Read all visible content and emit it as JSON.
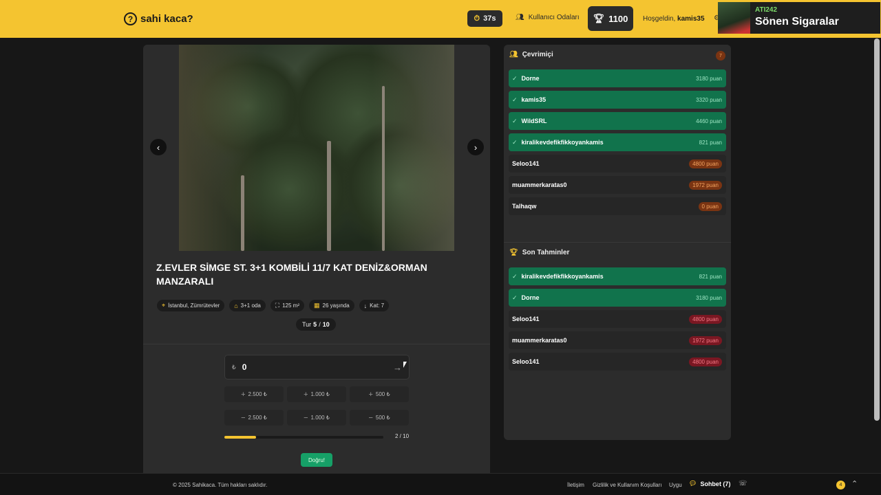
{
  "header": {
    "logo_text": "sahi kaca?",
    "timer": "37s",
    "rooms_label": "Kullanıcı Odaları",
    "score": "1100",
    "welcome_prefix": "Hoşgeldin,",
    "username": "kamis35",
    "notification": {
      "title": "ATI242",
      "subtitle": "Sönen Sigaralar"
    }
  },
  "listing": {
    "title": "Z.EVLER SİMGE ST. 3+1 KOMBİLİ 11/7 KAT DENİZ&ORMAN MANZARALI",
    "chips": [
      {
        "icon": "location-icon",
        "label": "İstanbul, Zümrütevler"
      },
      {
        "icon": "home-icon",
        "label": "3+1 oda"
      },
      {
        "icon": "area-icon",
        "label": "125 m²"
      },
      {
        "icon": "building-icon",
        "label": "26 yaşında"
      },
      {
        "icon": "floor-arrow-icon",
        "label": "Kat: 7"
      }
    ],
    "round_label": "Tur",
    "round_current": "5",
    "round_sep": "/",
    "round_total": "10"
  },
  "guess": {
    "currency": "₺",
    "value": "0",
    "buttons_plus": [
      "2.500 ₺",
      "1.000 ₺",
      "500 ₺"
    ],
    "buttons_minus": [
      "2.500 ₺",
      "1.000 ₺",
      "500 ₺"
    ],
    "progress_fraction": 0.2,
    "progress_text": "2 / 10",
    "correct_label": "Doğru!"
  },
  "online": {
    "title": "Çevrimiçi",
    "count": "7",
    "users": [
      {
        "name": "Dorne",
        "points": "3180 puan",
        "guessed": true
      },
      {
        "name": "kamis35",
        "points": "3320 puan",
        "guessed": true
      },
      {
        "name": "WildSRL",
        "points": "4460 puan",
        "guessed": true
      },
      {
        "name": "kiralikevdefikfikkoyankamis",
        "points": "821 puan",
        "guessed": true
      },
      {
        "name": "Seloo141",
        "points": "4800 puan",
        "guessed": false
      },
      {
        "name": "muammerkaratas0",
        "points": "1972 puan",
        "guessed": false
      },
      {
        "name": "Talhaqw",
        "points": "0 puan",
        "guessed": false
      }
    ]
  },
  "recent": {
    "title": "Son Tahminler",
    "guesses": [
      {
        "name": "kiralikevdefikfikkoyankamis",
        "points": "821 puan",
        "correct": true
      },
      {
        "name": "Dorne",
        "points": "3180 puan",
        "correct": true
      },
      {
        "name": "Seloo141",
        "points": "4800 puan",
        "correct": false
      },
      {
        "name": "muammerkaratas0",
        "points": "1972 puan",
        "correct": false
      },
      {
        "name": "Seloo141",
        "points": "4800 puan",
        "correct": false
      }
    ]
  },
  "footer": {
    "copyright": "© 2025 Sahikaca. Tüm hakları saklıdır.",
    "links": [
      "İletişim",
      "Gizlilik ve Kullanım Koşulları",
      "Uygu"
    ],
    "chat_label": "Sohbet (7)",
    "badge": "4"
  },
  "colors": {
    "accent": "#f4c430",
    "success": "#11734c",
    "danger_pill": "#7a1722",
    "warn_pill": "#7a3412"
  }
}
